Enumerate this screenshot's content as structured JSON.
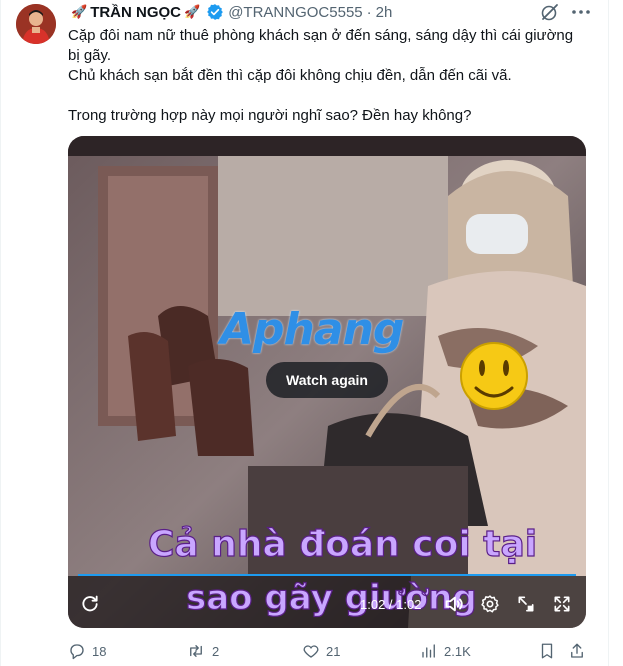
{
  "colors": {
    "accent": "#1d9bf0",
    "text_primary": "#0f1419",
    "text_secondary": "#536471",
    "caption_fill": "#c9a6ff",
    "watermark": "#2f8fe6"
  },
  "post": {
    "author": {
      "display_name": "TRẦN NGỌC",
      "emoji": "🚀",
      "handle": "@TRANNGOC5555",
      "separator": "·",
      "time_ago": "2h",
      "verified": true
    },
    "text": {
      "line1": "Cặp đôi nam nữ thuê phòng khách sạn ở đến sáng, sáng dậy thì cái giường bị gãy.",
      "line2": "Chủ khách sạn bắt đền thì cặp đôi không chịu đền, dẫn đến cãi vã.",
      "line3": "Trong trường hợp này mọi người nghĩ sao? Đền hay không?"
    },
    "video": {
      "watermark": "Aphang",
      "watch_again_label": "Watch again",
      "caption_line1": "Cả nhà đoán coi tại",
      "caption_line2": "sao gãy giường",
      "time_readout": "1:02 / 1:02",
      "progress": 1.0,
      "icons": [
        "replay-icon",
        "volume-icon",
        "settings-icon",
        "picture-in-picture-icon",
        "fullscreen-icon"
      ]
    },
    "stats": {
      "replies": "18",
      "reposts": "2",
      "likes": "21",
      "views": "2.1K"
    }
  }
}
